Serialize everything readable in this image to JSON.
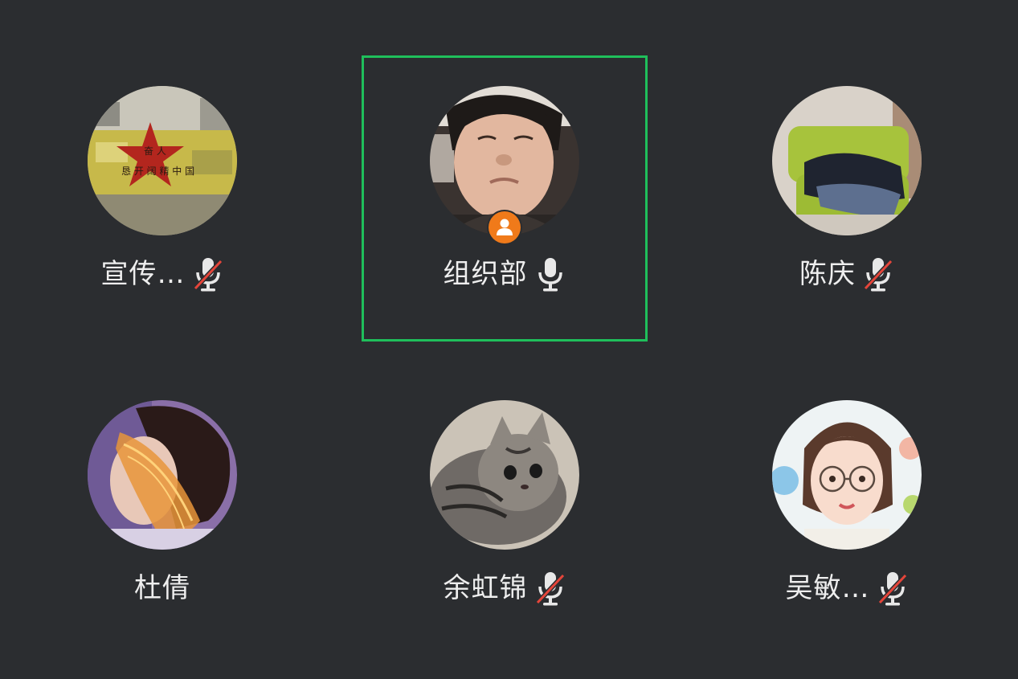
{
  "participants": [
    {
      "name": "宣传…",
      "mic": "muted",
      "active": false,
      "host": false,
      "avatar": "red-star-wall-photo"
    },
    {
      "name": "组织部",
      "mic": "on",
      "active": true,
      "host": true,
      "avatar": "young-man-selfie"
    },
    {
      "name": "陈庆",
      "mic": "muted",
      "active": false,
      "host": false,
      "avatar": "green-chair-clothes-photo"
    },
    {
      "name": "杜倩",
      "mic": "none",
      "active": false,
      "host": false,
      "avatar": "woman-lace-veil-photo"
    },
    {
      "name": "余虹锦",
      "mic": "muted",
      "active": false,
      "host": false,
      "avatar": "tabby-cat-photo"
    },
    {
      "name": "吴敏…",
      "mic": "muted",
      "active": false,
      "host": false,
      "avatar": "cartoon-girl-glasses-illustration"
    }
  ],
  "colors": {
    "background": "#2b2d30",
    "active_border": "#1fbf5b",
    "host_badge": "#f07a1a",
    "muted_slash": "#e5453a",
    "text": "#eeeeee"
  },
  "icons": {
    "mic_on": "microphone-icon",
    "mic_muted": "microphone-muted-icon",
    "host": "host-person-icon"
  }
}
